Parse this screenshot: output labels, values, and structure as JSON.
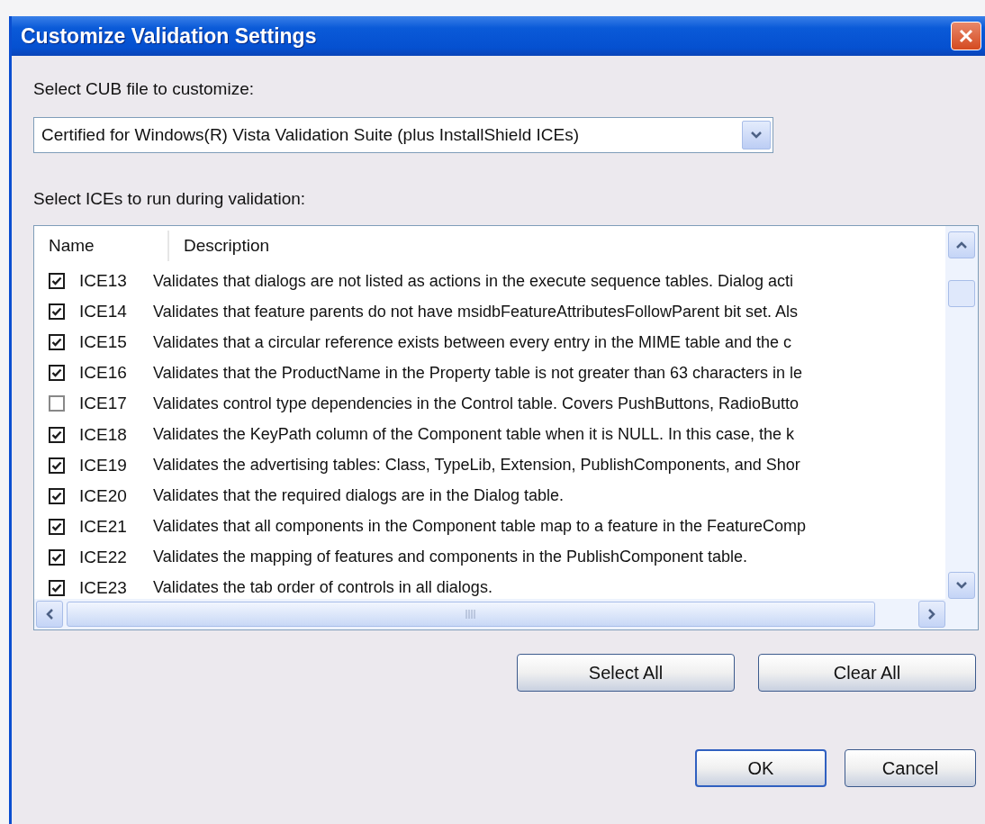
{
  "window": {
    "title": "Customize Validation Settings"
  },
  "cub": {
    "label": "Select CUB file to customize:",
    "value": "Certified for Windows(R) Vista Validation Suite (plus InstallShield ICEs)"
  },
  "ices_label": "Select ICEs to run during validation:",
  "table": {
    "columns": [
      "Name",
      "Description"
    ],
    "rows": [
      {
        "name": "ICE13",
        "description": "Validates that dialogs are not listed as actions in the execute sequence tables. Dialog acti",
        "checked": true
      },
      {
        "name": "ICE14",
        "description": "Validates that feature parents do not have msidbFeatureAttributesFollowParent bit set. Als",
        "checked": true
      },
      {
        "name": "ICE15",
        "description": "Validates that a circular reference exists between every entry in the MIME table and the c",
        "checked": true
      },
      {
        "name": "ICE16",
        "description": "Validates that the ProductName in the Property table is not greater than 63 characters in le",
        "checked": true
      },
      {
        "name": "ICE17",
        "description": "Validates control type dependencies in the Control table. Covers PushButtons, RadioButto",
        "checked": false
      },
      {
        "name": "ICE18",
        "description": "Validates the KeyPath column of the Component table when it is NULL. In this case, the k",
        "checked": true
      },
      {
        "name": "ICE19",
        "description": "Validates the advertising tables: Class, TypeLib, Extension, PublishComponents, and Shor",
        "checked": true
      },
      {
        "name": "ICE20",
        "description": "Validates that the required dialogs are in the Dialog table.",
        "checked": true
      },
      {
        "name": "ICE21",
        "description": "Validates that all components in the Component table map to a feature in the FeatureComp",
        "checked": true
      },
      {
        "name": "ICE22",
        "description": "Validates the mapping of features and components in the PublishComponent table.",
        "checked": true
      },
      {
        "name": "ICE23",
        "description": "Validates the tab order of controls in all dialogs.",
        "checked": true
      }
    ]
  },
  "list_buttons": [
    "Select All",
    "Clear All"
  ],
  "dialog_buttons": [
    {
      "label": "OK",
      "default": true
    },
    {
      "label": "Cancel",
      "default": false
    }
  ]
}
